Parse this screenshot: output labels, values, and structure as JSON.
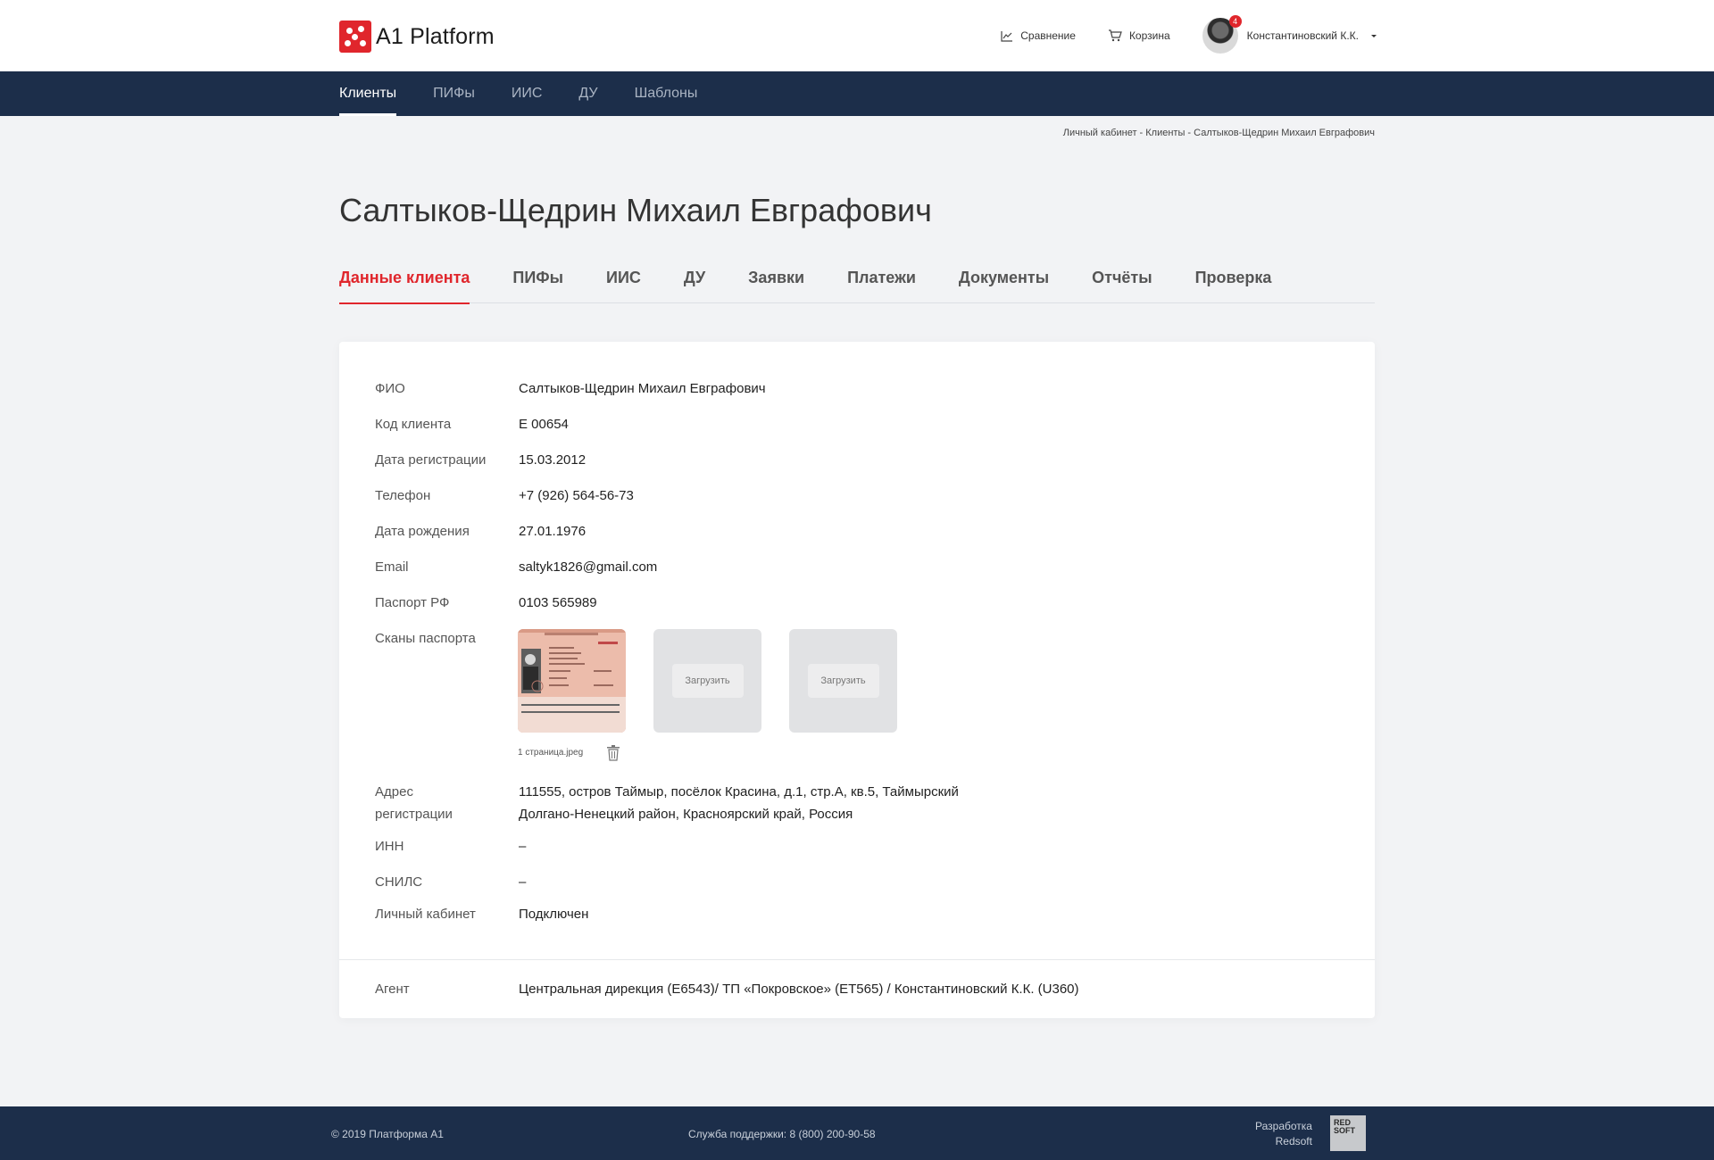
{
  "app": {
    "name": "A1 Platform"
  },
  "header": {
    "compare_label": "Сравнение",
    "cart_label": "Корзина",
    "user_name": "Константиновский К.К.",
    "notifications": "4"
  },
  "nav": {
    "items": [
      {
        "label": "Клиенты",
        "active": true
      },
      {
        "label": "ПИФы"
      },
      {
        "label": "ИИС"
      },
      {
        "label": "ДУ"
      },
      {
        "label": "Шаблоны"
      }
    ]
  },
  "breadcrumb": "Личный кабинет - Клиенты - Салтыков-Щедрин Михаил Евграфович",
  "page_title": "Салтыков-Щедрин Михаил Евграфович",
  "tabs": [
    {
      "label": "Данные клиента",
      "active": true
    },
    {
      "label": "ПИФы"
    },
    {
      "label": "ИИС"
    },
    {
      "label": "ДУ"
    },
    {
      "label": "Заявки"
    },
    {
      "label": "Платежи"
    },
    {
      "label": "Документы"
    },
    {
      "label": "Отчёты"
    },
    {
      "label": "Проверка"
    }
  ],
  "client": {
    "fio_label": "ФИО",
    "fio": "Салтыков-Щедрин Михаил Евграфович",
    "code_label": "Код клиента",
    "code": "E 00654",
    "reg_date_label": "Дата регистрации",
    "reg_date": "15.03.2012",
    "phone_label": "Телефон",
    "phone": "+7 (926) 564-56-73",
    "birth_label": "Дата рождения",
    "birth": "27.01.1976",
    "email_label": "Email",
    "email": "saltyk1826@gmail.com",
    "passport_label": "Паспорт РФ",
    "passport": "0103 565989",
    "scans_label": "Сканы паспорта",
    "scan_file": "1 страница.jpeg",
    "upload_label": "Загрузить",
    "address_label_1": "Адрес",
    "address_label_2": "регистрации",
    "address_line_1": "111555, остров Таймыр, посёлок Красина, д.1, стр.А, кв.5, Таймырский",
    "address_line_2": "Долгано-Ненецкий район, Красноярский край, Россия",
    "inn_label": "ИНН",
    "inn": "–",
    "snils_label": "СНИЛС",
    "snils": "–",
    "cabinet_label": "Личный кабинет",
    "cabinet": "Подключен",
    "agent_label": "Агент",
    "agent": "Центральная дирекция (E6543)/ ТП «Покровское» (ET565) / Константиновский К.К. (U360)"
  },
  "footer": {
    "copyright": "© 2019  Платформа А1",
    "support": "Служба поддержки:   8 (800) 200-90-58",
    "dev_1": "Разработка",
    "dev_2": "Redsoft",
    "logo_1": "RED",
    "logo_2": "SOFT"
  }
}
